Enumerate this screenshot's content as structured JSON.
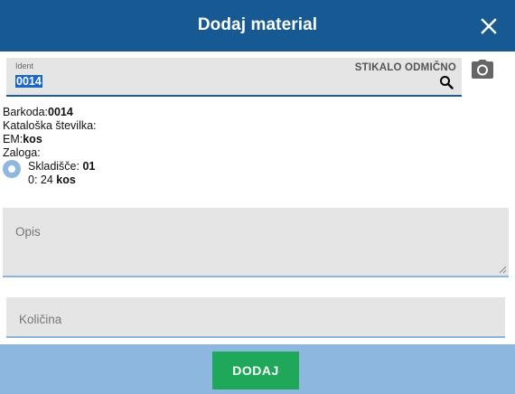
{
  "header": {
    "title": "Dodaj material",
    "close_icon": "close-icon"
  },
  "ident": {
    "label": "Ident",
    "value": "0014",
    "switch_label": "STIKALO ODMIČNO",
    "search_icon": "search-icon",
    "camera_icon": "camera-icon"
  },
  "info": {
    "barcode_label": "Barkoda:",
    "barcode_value": "0014",
    "catalog_label": "Kataloška številka:",
    "unit_label": "EM:",
    "unit_value": "kos",
    "stock_label": "Zaloga:",
    "warehouse_label": "Skladišče:",
    "warehouse_value": "01",
    "qty_prefix": "0: 24",
    "qty_unit": "kos"
  },
  "opis": {
    "placeholder": "Opis"
  },
  "kolicina": {
    "placeholder": "Količina"
  },
  "footer": {
    "add_label": "DODAJ"
  },
  "colors": {
    "header": "#175a93",
    "footer": "#8db7de",
    "button": "#1fa859",
    "field": "#e5e5e5"
  }
}
